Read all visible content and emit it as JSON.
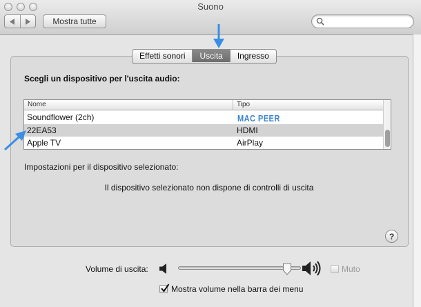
{
  "window": {
    "title": "Suono"
  },
  "toolbar": {
    "show_all_label": "Mostra tutte",
    "search_placeholder": "",
    "search_value": ""
  },
  "tabs": [
    {
      "label": "Effetti sonori",
      "selected": false
    },
    {
      "label": "Uscita",
      "selected": true
    },
    {
      "label": "Ingresso",
      "selected": false
    }
  ],
  "output": {
    "heading": "Scegli un dispositivo per l'uscita audio:",
    "table": {
      "columns": [
        "Nome",
        "Tipo"
      ],
      "rows": [
        {
          "name": "Soundflower (2ch)",
          "type": "",
          "selected": false
        },
        {
          "name": "22EA53",
          "type": "HDMI",
          "selected": true
        },
        {
          "name": "Apple TV",
          "type": "AirPlay",
          "selected": false
        }
      ]
    },
    "watermark": "MAC PEER",
    "settings_label": "Impostazioni per il dispositivo selezionato:",
    "no_controls_message": "Il dispositivo selezionato non dispone di controlli di uscita"
  },
  "help": {
    "label": "?"
  },
  "volume": {
    "label": "Volume di uscita:",
    "level": 0.92,
    "mute_label": "Muto",
    "mute_checked": false,
    "show_in_menubar_label": "Mostra volume nella barra dei menu",
    "show_in_menubar_checked": true
  },
  "colors": {
    "selected_row": "#d3d3d3",
    "selected_tab": "#7a7a7a",
    "annotation_arrow": "#3a8ee6",
    "watermark": "#3b86d0"
  }
}
